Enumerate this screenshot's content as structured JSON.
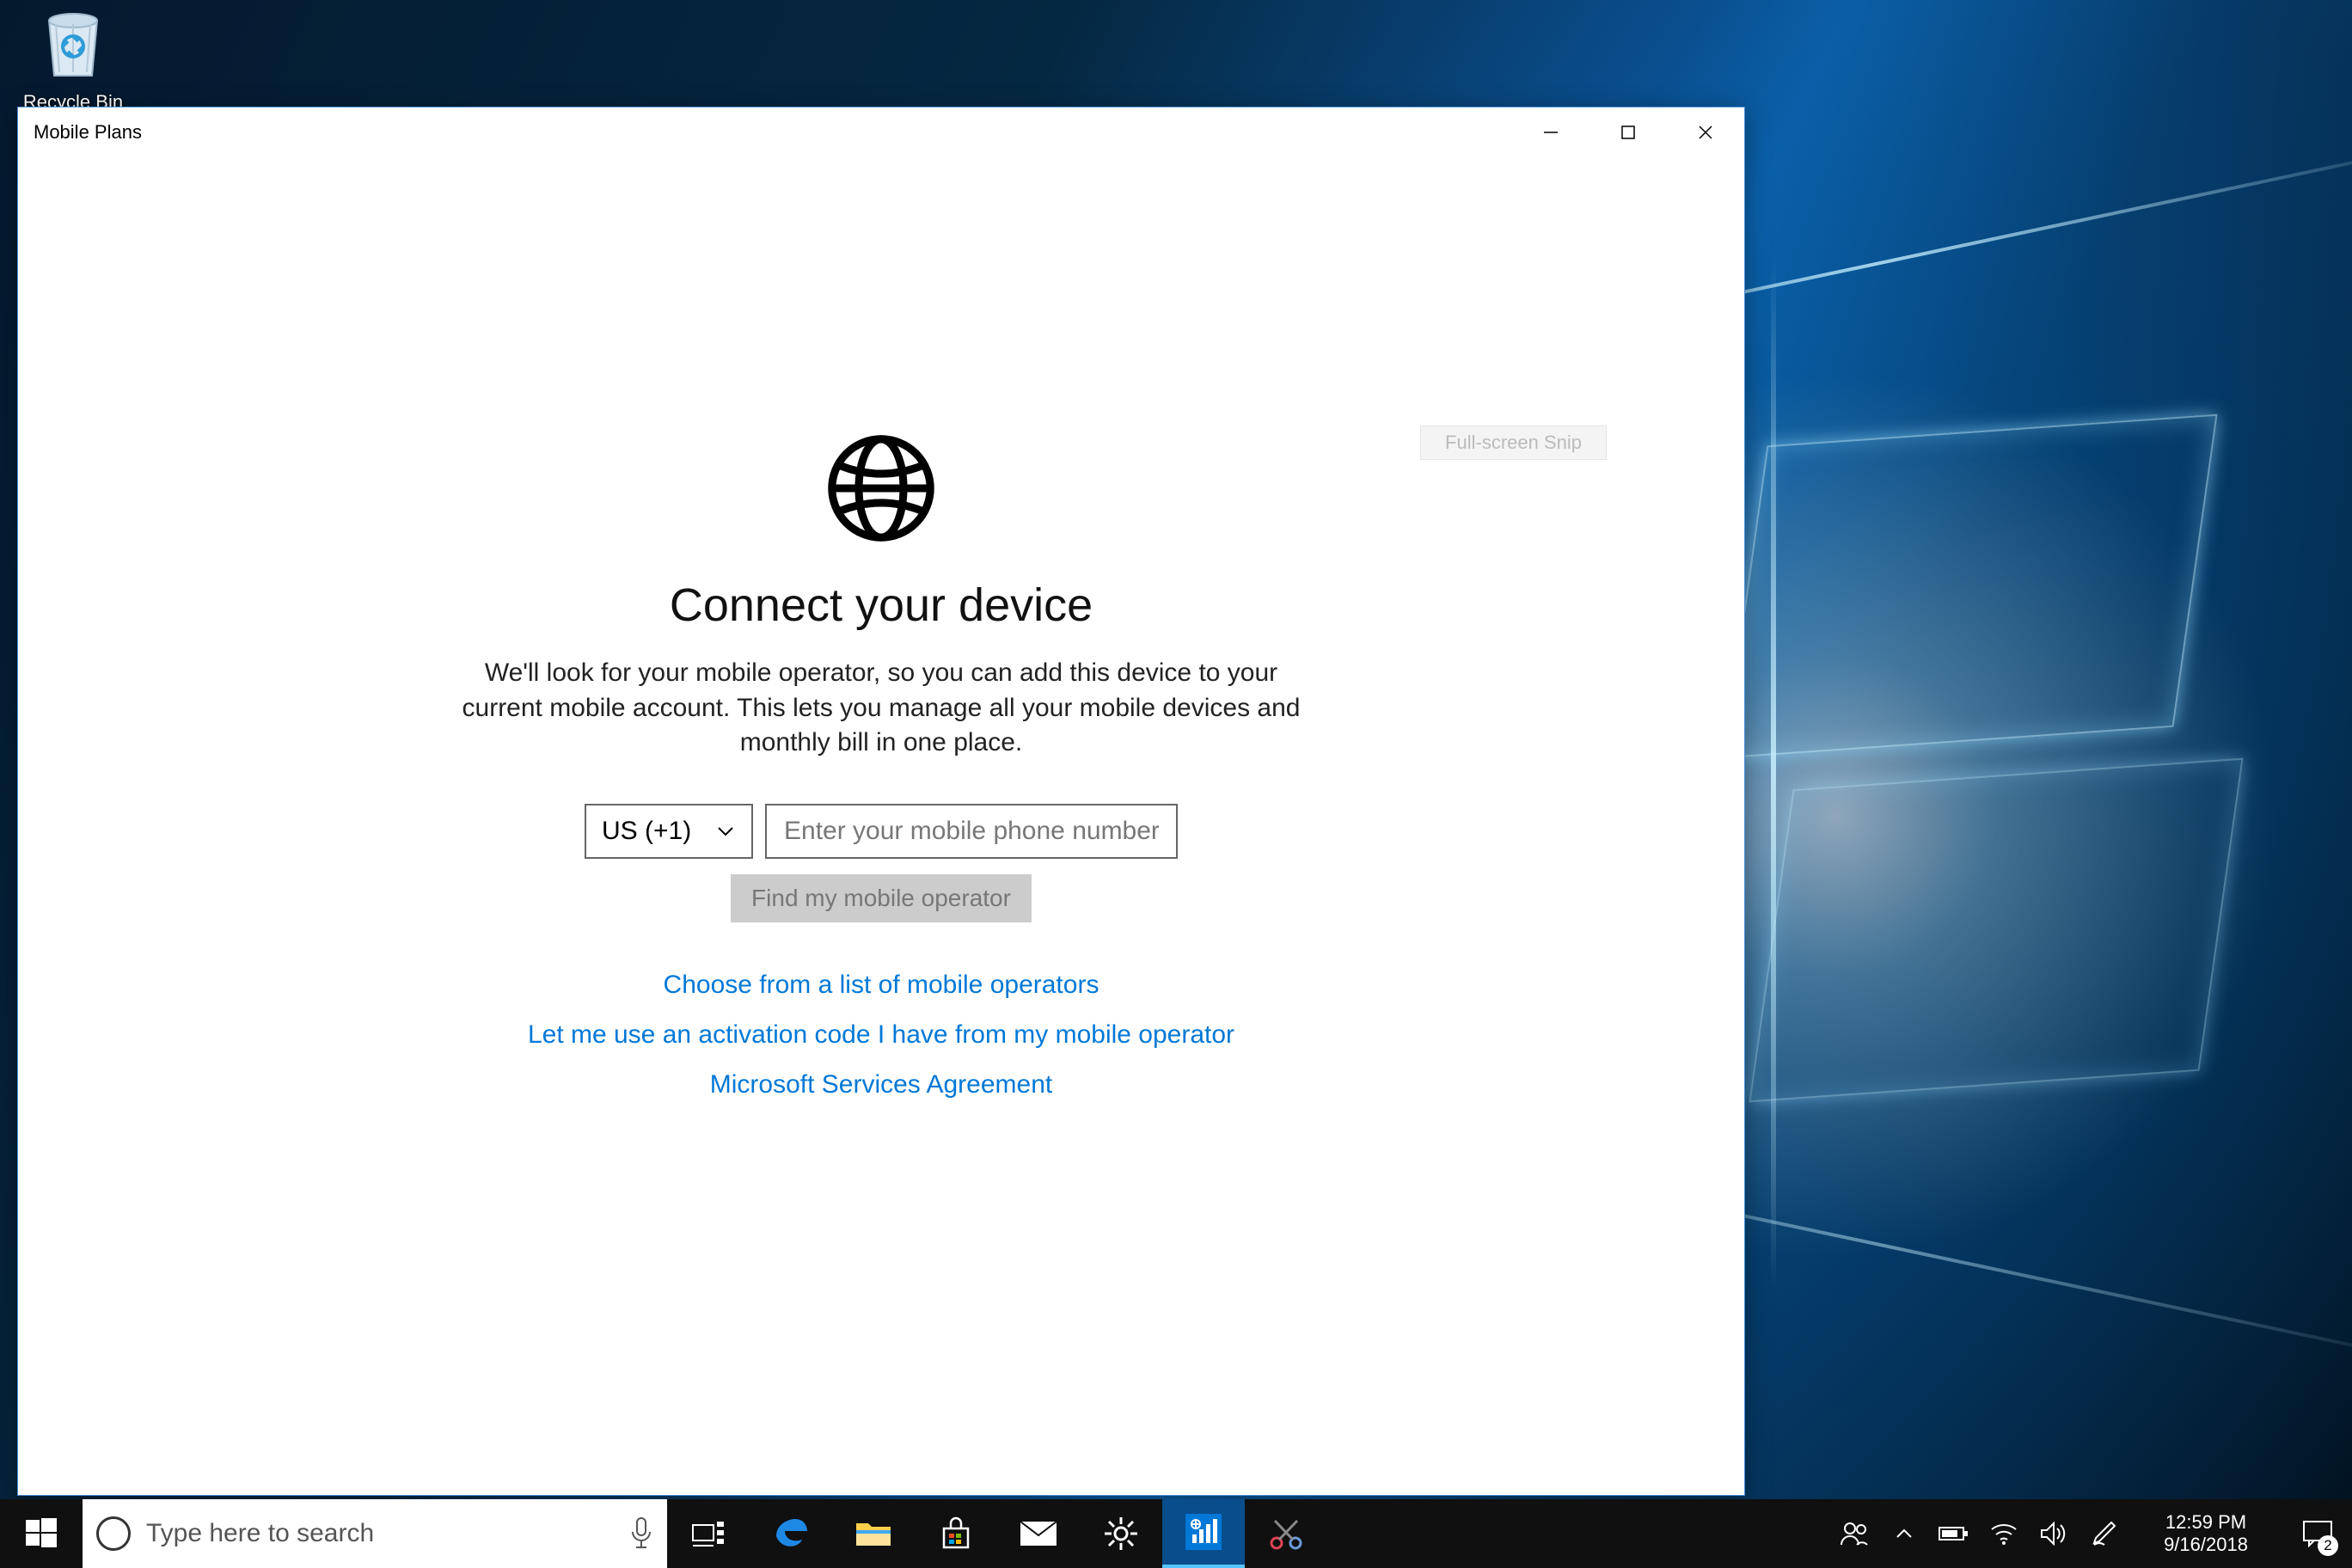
{
  "desktop": {
    "recycle_bin_label": "Recycle Bin"
  },
  "window": {
    "title": "Mobile Plans",
    "ghost_tooltip": "Full-screen Snip",
    "heading": "Connect your device",
    "subtext": "We'll look for your mobile operator, so you can add this device to your current mobile account. This lets you manage all your mobile devices and monthly bill in one place.",
    "country_code": "US (+1)",
    "phone_placeholder": "Enter your mobile phone number",
    "find_button": "Find my mobile operator",
    "link_choose": "Choose from a list of mobile operators",
    "link_activation": "Let me use an activation code I have from my mobile operator",
    "link_agreement": "Microsoft Services Agreement"
  },
  "taskbar": {
    "search_placeholder": "Type here to search",
    "time": "12:59 PM",
    "date": "9/16/2018",
    "notification_count": "2"
  }
}
